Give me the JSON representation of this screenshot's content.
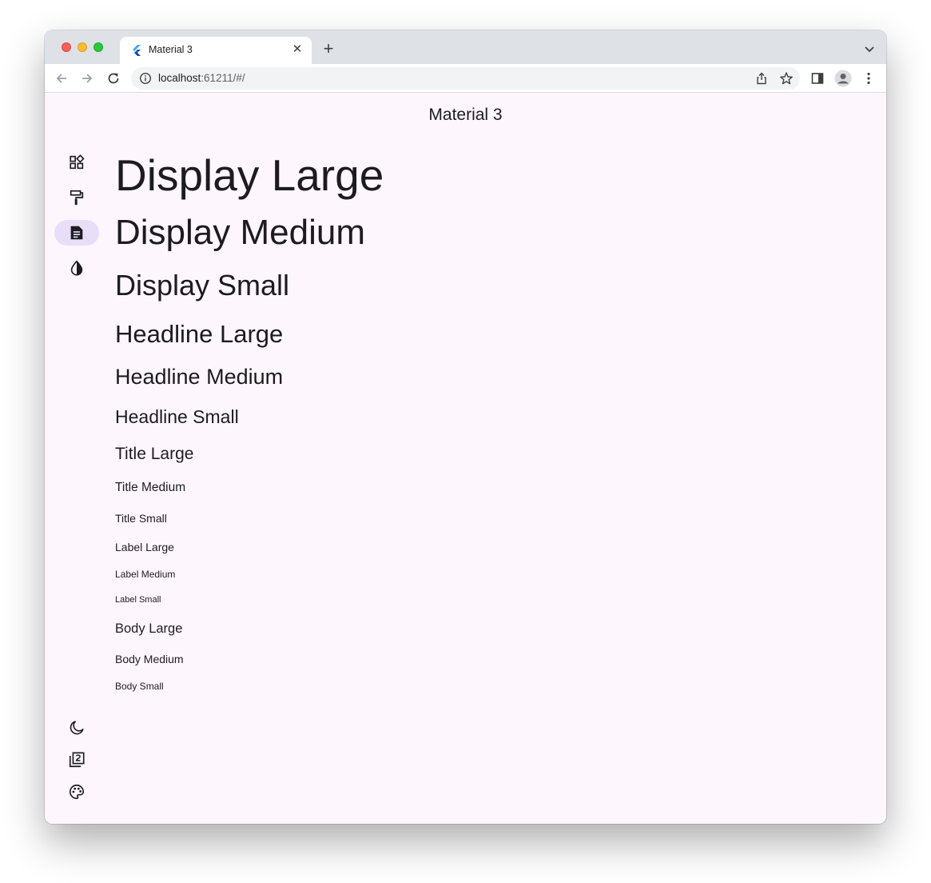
{
  "browser": {
    "tab_title": "Material 3",
    "new_tab_label": "+",
    "close_label": "✕",
    "url_host": "localhost",
    "url_rest": ":61211/#/"
  },
  "app": {
    "title": "Material 3",
    "rail_top_items": [
      {
        "icon": "widgets-icon",
        "selected": false
      },
      {
        "icon": "format-paint-icon",
        "selected": false
      },
      {
        "icon": "text-snippet-icon",
        "selected": true
      },
      {
        "icon": "invert-colors-icon",
        "selected": false
      }
    ],
    "rail_bottom_items": [
      {
        "icon": "dark-mode-icon"
      },
      {
        "icon": "filter-2-icon"
      },
      {
        "icon": "palette-icon"
      }
    ],
    "type_scale": [
      "Display Large",
      "Display Medium",
      "Display Small",
      "Headline Large",
      "Headline Medium",
      "Headline Small",
      "Title Large",
      "Title Medium",
      "Title Small",
      "Label Large",
      "Label Medium",
      "Label Small",
      "Body Large",
      "Body Medium",
      "Body Small"
    ]
  },
  "colors": {
    "background": "#fdf7fd",
    "on_surface": "#1d1b20",
    "selected_indicator": "#e8def8"
  }
}
